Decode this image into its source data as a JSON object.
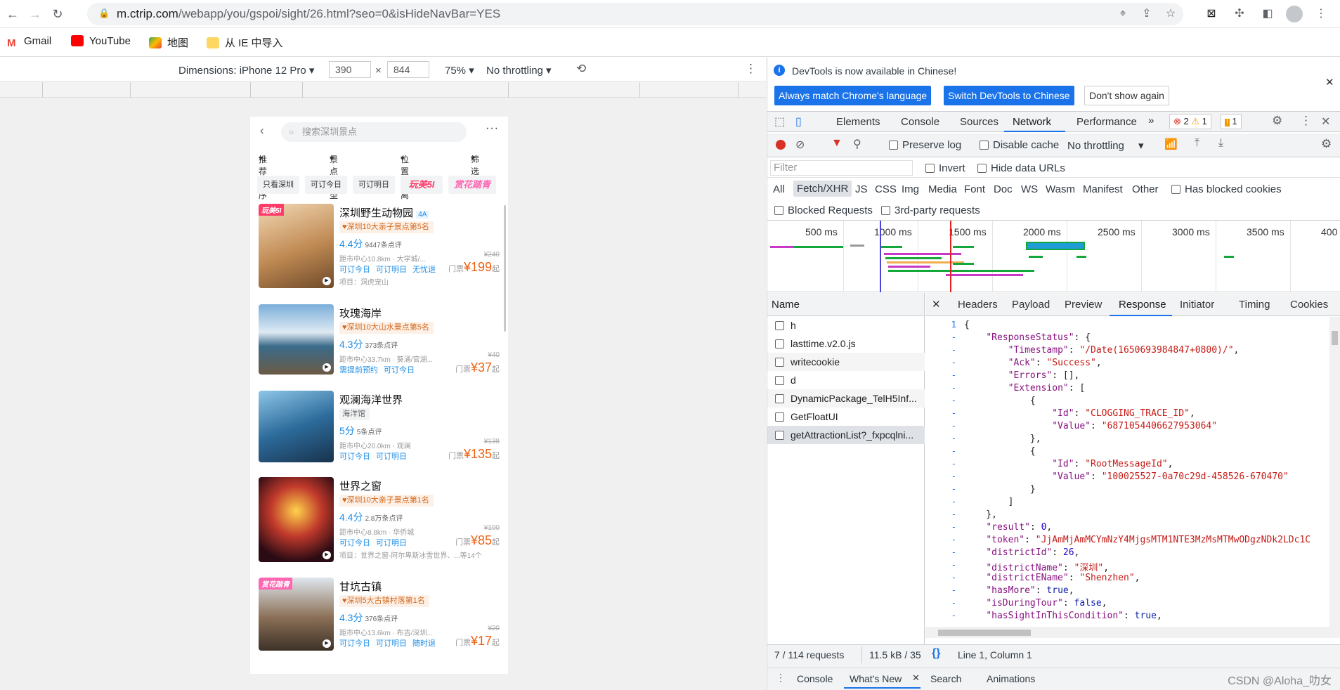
{
  "browser": {
    "url_host": "m.ctrip.com",
    "url_path": "/webapp/you/gspoi/sight/26.html?seo=0&isHideNavBar=YES",
    "bookmarks": [
      "Gmail",
      "YouTube",
      "地图",
      "从 IE 中导入"
    ]
  },
  "device_toolbar": {
    "dimensions": "Dimensions: iPhone 12 Pro",
    "width": "390",
    "height": "844",
    "times": "×",
    "zoom": "75%",
    "throttling": "No throttling"
  },
  "phone": {
    "search_placeholder": "搜索深圳景点",
    "filters": [
      "推荐排序",
      "景点类型",
      "位置距离",
      "筛选"
    ],
    "chips": [
      "只看深圳",
      "可订今日",
      "可订明日",
      "玩美5I",
      "赏花踏青"
    ],
    "items": [
      {
        "name": "深圳野生动物园",
        "level": "4A",
        "badge": "玩美5I",
        "tag": "深圳10大亲子景点第5名",
        "score": "4.4分",
        "reviews": "9447条点评",
        "dist": "距市中心10.8km · 大学城/...",
        "orig": "¥240",
        "book": [
          "可订今日",
          "可订明日",
          "无忧退"
        ],
        "price_prefix": "门票",
        "price": "¥199",
        "price_suffix": "起",
        "proj": "项目：洞虎宠山"
      },
      {
        "name": "玫瑰海岸",
        "tag": "深圳10大山水景点第5名",
        "score": "4.3分",
        "reviews": "373条点评",
        "dist": "距市中心33.7km · 葵涌/官湖...",
        "orig": "¥40",
        "book": [
          "需提前预约",
          "可订今日"
        ],
        "price_prefix": "门票",
        "price": "¥37",
        "price_suffix": "起"
      },
      {
        "name": "观澜海洋世界",
        "tag": "海洋馆",
        "score": "5分",
        "reviews": "5条点评",
        "dist": "距市中心20.0km · 观澜",
        "orig": "¥138",
        "book": [
          "可订今日",
          "可订明日"
        ],
        "price_prefix": "门票",
        "price": "¥135",
        "price_suffix": "起"
      },
      {
        "name": "世界之窗",
        "tag": "深圳10大亲子景点第1名",
        "score": "4.4分",
        "reviews": "2.8万条点评",
        "dist": "距市中心8.8km · 华侨城",
        "orig": "¥100",
        "book": [
          "可订今日",
          "可订明日"
        ],
        "price_prefix": "门票",
        "price": "¥85",
        "price_suffix": "起",
        "proj": "项目：世界之窗-阿尔卑斯冰雪世界、...等14个"
      },
      {
        "name": "甘坑古镇",
        "badge": "赏花踏青",
        "tag": "深圳5大古镇村落第1名",
        "score": "4.3分",
        "reviews": "376条点评",
        "dist": "距市中心13.6km · 布吉/深圳...",
        "orig": "¥20",
        "book": [
          "可订今日",
          "可订明日",
          "随时退"
        ],
        "price_prefix": "门票",
        "price": "¥17",
        "price_suffix": "起"
      }
    ]
  },
  "devtools": {
    "info_text": "DevTools is now available in Chinese!",
    "btn_match": "Always match Chrome's language",
    "btn_switch": "Switch DevTools to Chinese",
    "btn_dont": "Don't show again",
    "tabs": [
      "Elements",
      "Console",
      "Sources",
      "Network",
      "Performance"
    ],
    "errors": "2",
    "warnings": "1",
    "issues": "1",
    "preserve_log": "Preserve log",
    "disable_cache": "Disable cache",
    "throttling": "No throttling",
    "filter_placeholder": "Filter",
    "invert": "Invert",
    "hide_data_urls": "Hide data URLs",
    "types": [
      "All",
      "Fetch/XHR",
      "JS",
      "CSS",
      "Img",
      "Media",
      "Font",
      "Doc",
      "WS",
      "Wasm",
      "Manifest",
      "Other"
    ],
    "has_blocked_cookies": "Has blocked cookies",
    "blocked_requests": "Blocked Requests",
    "third_party": "3rd-party requests",
    "timeline_labels": [
      "500 ms",
      "1000 ms",
      "1500 ms",
      "2000 ms",
      "2500 ms",
      "3000 ms",
      "3500 ms",
      "400"
    ],
    "name_header": "Name",
    "requests": [
      "h",
      "lasttime.v2.0.js",
      "writecookie",
      "d",
      "DynamicPackage_TelH5Inf...",
      "GetFloatUI",
      "getAttractionList?_fxpcqlni..."
    ],
    "detail_tabs": [
      "Headers",
      "Payload",
      "Preview",
      "Response",
      "Initiator",
      "Timing",
      "Cookies"
    ],
    "status_requests": "7 / 114 requests",
    "status_size": "11.5 kB / 35",
    "cursor_pos": "Line 1, Column 1",
    "drawer_tabs": [
      "Console",
      "What's New",
      "Search",
      "Animations"
    ]
  },
  "response_lines": [
    [
      "1",
      "{"
    ],
    [
      "-",
      "    \"ResponseStatus\": {"
    ],
    [
      "-",
      "        \"Timestamp\": \"/Date(1650693984847+0800)/\","
    ],
    [
      "-",
      "        \"Ack\": \"Success\","
    ],
    [
      "-",
      "        \"Errors\": [],"
    ],
    [
      "-",
      "        \"Extension\": ["
    ],
    [
      "-",
      "            {"
    ],
    [
      "-",
      "                \"Id\": \"CLOGGING_TRACE_ID\","
    ],
    [
      "-",
      "                \"Value\": \"6871054406627953064\""
    ],
    [
      "-",
      "            },"
    ],
    [
      "-",
      "            {"
    ],
    [
      "-",
      "                \"Id\": \"RootMessageId\","
    ],
    [
      "-",
      "                \"Value\": \"100025527-0a70c29d-458526-670470\""
    ],
    [
      "-",
      "            }"
    ],
    [
      "-",
      "        ]"
    ],
    [
      "-",
      "    },"
    ],
    [
      "-",
      "    \"result\": 0,"
    ],
    [
      "-",
      "    \"token\": \"JjAmMjAmMCYmNzY4MjgsMTM1NTE3MzMsMTMwODgzNDk2LDc1C"
    ],
    [
      "-",
      "    \"districtId\": 26,"
    ],
    [
      "-",
      "    \"districtName\": \"深圳\","
    ],
    [
      "-",
      "    \"districtEName\": \"Shenzhen\","
    ],
    [
      "-",
      "    \"hasMore\": true,"
    ],
    [
      "-",
      "    \"isDuringTour\": false,"
    ],
    [
      "-",
      "    \"hasSightInThisCondition\": true,"
    ]
  ],
  "watermark": "CSDN @Aloha_叻女",
  "colors": {
    "accent": "#1a73e8",
    "price": "#f06010",
    "link": "#1e8ee6"
  }
}
